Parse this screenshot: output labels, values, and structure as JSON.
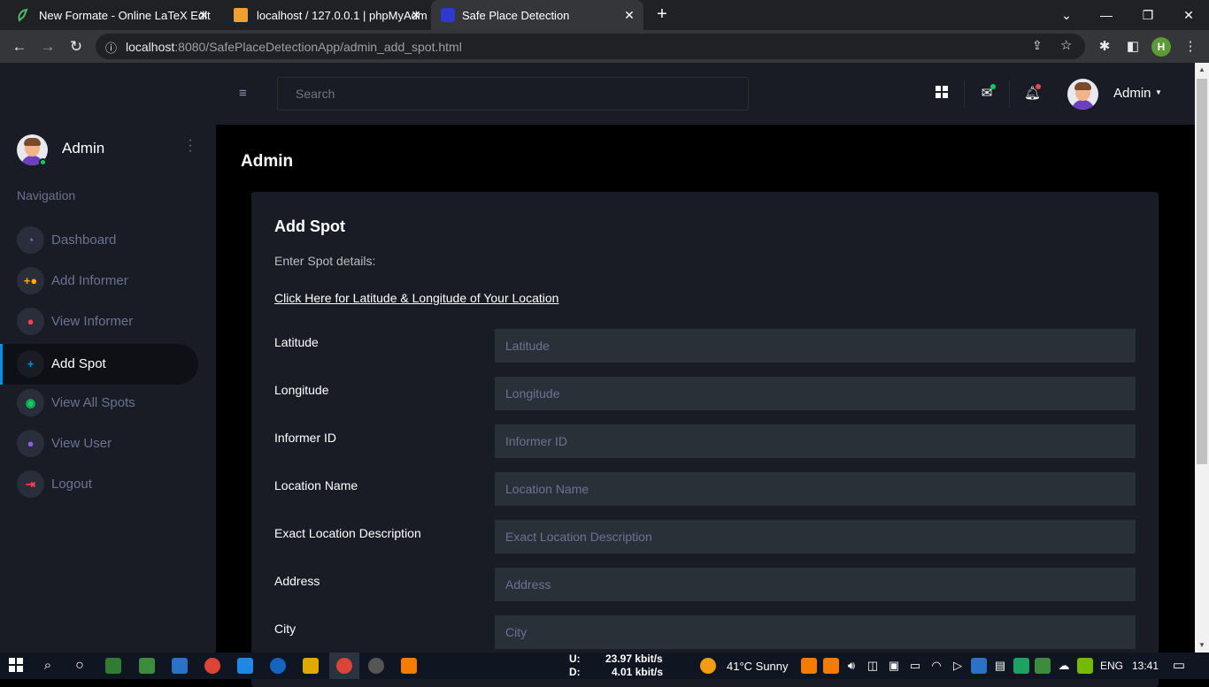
{
  "browser": {
    "tabs": [
      {
        "title": "New Formate - Online LaTeX Edit"
      },
      {
        "title": "localhost / 127.0.0.1 | phpMyAdm"
      },
      {
        "title": "Safe Place Detection"
      }
    ],
    "url_host": "localhost",
    "url_rest": ":8080/SafePlaceDetectionApp/admin_add_spot.html",
    "profile_initial": "H"
  },
  "sidebar": {
    "user_name": "Admin",
    "nav_label": "Navigation",
    "items": [
      {
        "label": "Dashboard",
        "icon": "speedometer-icon",
        "color": "#8f5fe8"
      },
      {
        "label": "Add Informer",
        "icon": "person-add-icon",
        "color": "#ffab00"
      },
      {
        "label": "View Informer",
        "icon": "person-icon",
        "color": "#fc424a"
      },
      {
        "label": "Add Spot",
        "icon": "plus-icon",
        "color": "#0090e7",
        "active": true
      },
      {
        "label": "View All Spots",
        "icon": "eye-icon",
        "color": "#00d25b"
      },
      {
        "label": "View User",
        "icon": "person-icon",
        "color": "#8f5fe8"
      },
      {
        "label": "Logout",
        "icon": "logout-icon",
        "color": "#fc424a"
      }
    ]
  },
  "topnav": {
    "search_placeholder": "Search",
    "user_name": "Admin"
  },
  "page": {
    "title": "Admin",
    "card_title": "Add Spot",
    "card_desc": "Enter Spot details:",
    "location_link": "Click Here for Latitude & Longitude of Your Location",
    "fields": [
      {
        "label": "Latitude",
        "placeholder": "Latitude"
      },
      {
        "label": "Longitude",
        "placeholder": "Longitude"
      },
      {
        "label": "Informer ID",
        "placeholder": "Informer ID"
      },
      {
        "label": "Location Name",
        "placeholder": "Location Name"
      },
      {
        "label": "Exact Location Description",
        "placeholder": "Exact Location Description"
      },
      {
        "label": "Address",
        "placeholder": "Address"
      },
      {
        "label": "City",
        "placeholder": "City"
      }
    ]
  },
  "taskbar": {
    "upload_label": "U:",
    "download_label": "D:",
    "upload_speed": "23.97 kbit/s",
    "download_speed": "4.01 kbit/s",
    "weather": "41°C  Sunny",
    "language": "ENG",
    "time": "13:41"
  }
}
